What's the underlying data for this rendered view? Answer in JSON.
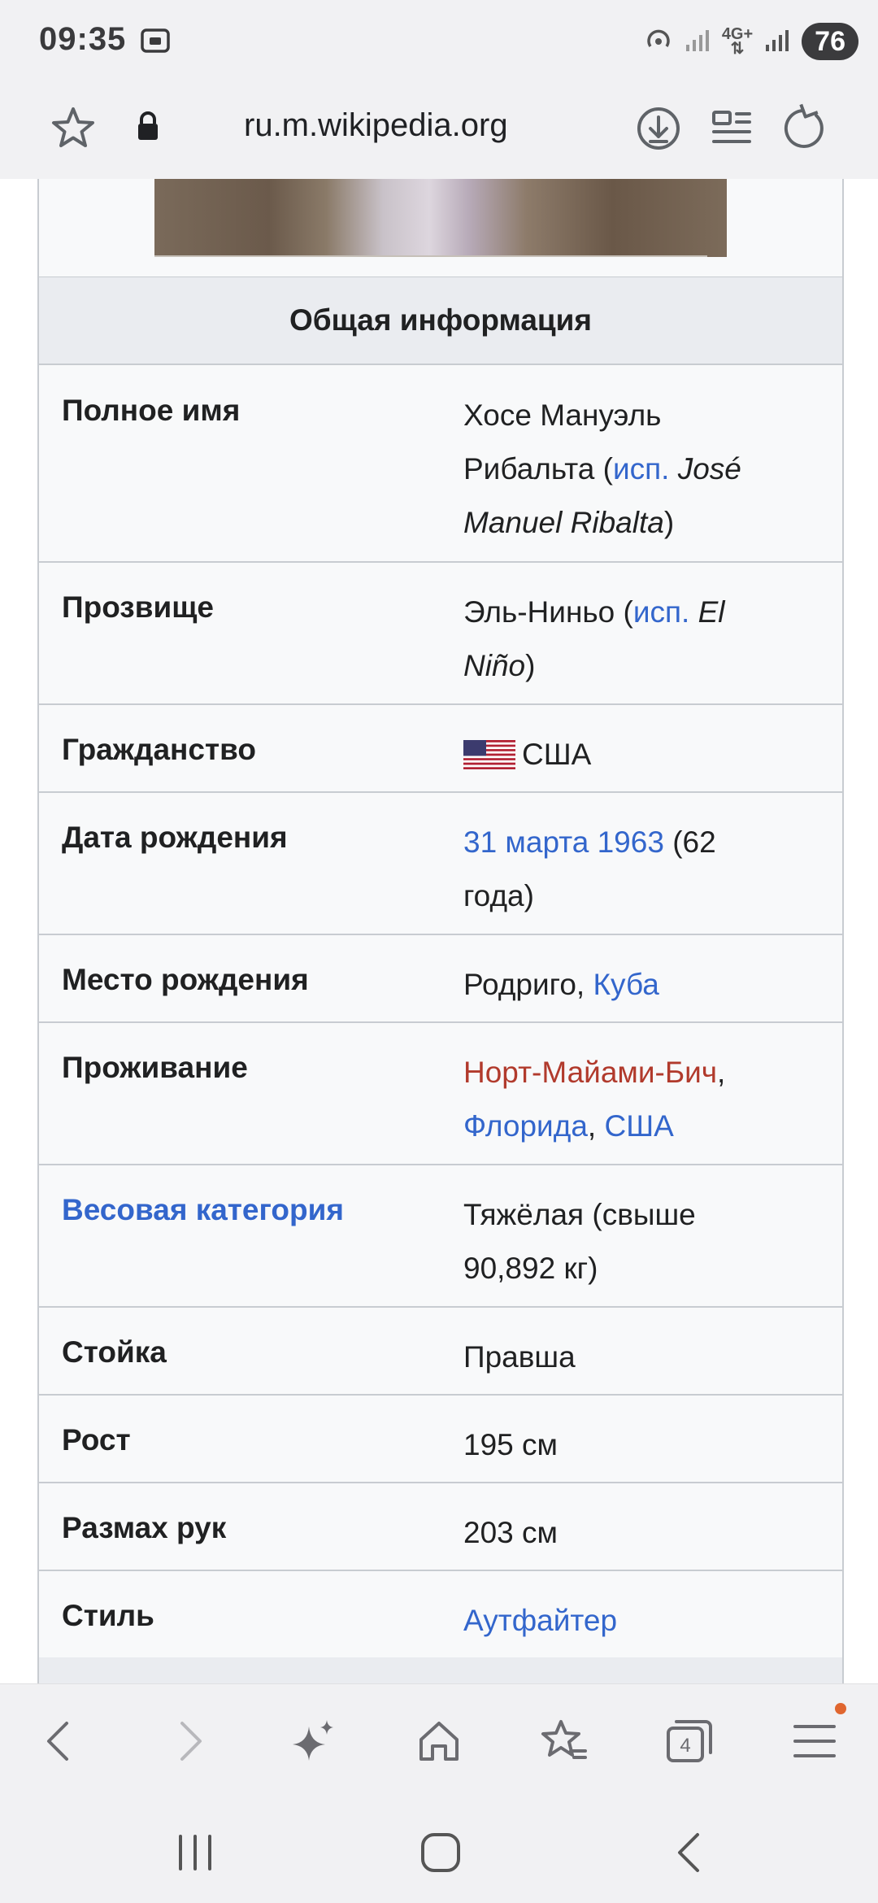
{
  "status_bar": {
    "time": "09:35",
    "network": "4G+",
    "battery": "76"
  },
  "address_bar": {
    "url": "ru.m.wikipedia.org"
  },
  "infobox": {
    "header": "Общая информация",
    "rows": [
      {
        "label": "Полное имя",
        "v1": "Хосе Мануэль",
        "v2": "Рибальта (",
        "v3": "исп.",
        "v4": " José",
        "v5": "Manuel Ribalta",
        "v6": ")"
      },
      {
        "label": "Прозвище",
        "v1": "Эль-Ниньо (",
        "v2": "исп.",
        "v3": " El",
        "v4": "Niño",
        "v5": ")"
      },
      {
        "label": "Гражданство",
        "v1": "США"
      },
      {
        "label": "Дата рождения",
        "v1": "31 марта 1963",
        "v2": " (62",
        "v3": "года)"
      },
      {
        "label": "Место рождения",
        "v1": "Родриго, ",
        "v2": "Куба"
      },
      {
        "label": "Проживание",
        "v1": "Норт-Майами-Бич",
        "v2": ",",
        "v3": "Флорида",
        "v4": ", ",
        "v5": "США"
      },
      {
        "label": "Весовая категория",
        "v1": "Тяжёлая (свыше",
        "v2": "90,892 кг)"
      },
      {
        "label": "Стойка",
        "v1": "Правша"
      },
      {
        "label": "Рост",
        "v1": "195 см"
      },
      {
        "label": "Размах рук",
        "v1": "203 см"
      },
      {
        "label": "Стиль",
        "v1": "Аутфайтер"
      }
    ]
  },
  "toolbar": {
    "tabs_count": "4"
  },
  "icons": {
    "bookmark": "star-icon",
    "lock": "lock-icon",
    "download": "download-icon",
    "reader": "reader-mode-icon",
    "reload": "reload-icon",
    "back": "back-arrow-icon",
    "forward": "forward-arrow-icon",
    "ai": "sparkle-icon",
    "home": "home-icon",
    "bookmarks": "bookmarks-icon",
    "tabs": "tabs-icon",
    "menu": "menu-icon"
  },
  "colors": {
    "link": "#3366cc",
    "redlink": "#b13a2c",
    "notification": "#e0662f"
  }
}
